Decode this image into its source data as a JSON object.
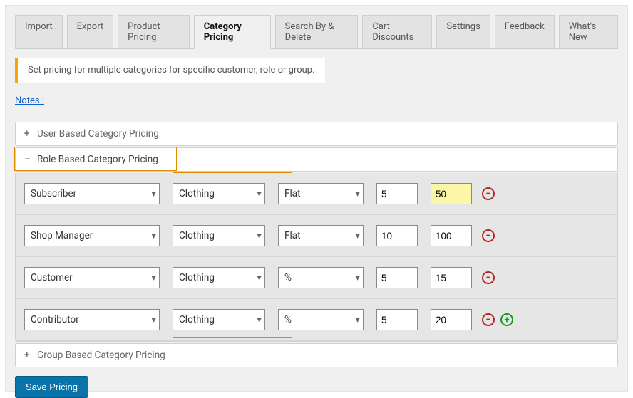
{
  "tabs": [
    "Import",
    "Export",
    "Product Pricing",
    "Category Pricing",
    "Search By & Delete",
    "Cart Discounts",
    "Settings",
    "Feedback",
    "What's New"
  ],
  "notice": "Set pricing for multiple categories for specific customer, role or group.",
  "notes_label": "Notes :",
  "sections": {
    "user": "User Based Category Pricing",
    "role": "Role Based Category Pricing",
    "group": "Group Based Category Pricing"
  },
  "rules": [
    {
      "role": "Subscriber",
      "category": "Clothing",
      "type": "Flat",
      "v1": "5",
      "v2": "50"
    },
    {
      "role": "Shop Manager",
      "category": "Clothing",
      "type": "Flat",
      "v1": "10",
      "v2": "100"
    },
    {
      "role": "Customer",
      "category": "Clothing",
      "type": "%",
      "v1": "5",
      "v2": "15"
    },
    {
      "role": "Contributor",
      "category": "Clothing",
      "type": "%",
      "v1": "5",
      "v2": "20"
    }
  ],
  "buttons": {
    "save": "Save Pricing"
  }
}
